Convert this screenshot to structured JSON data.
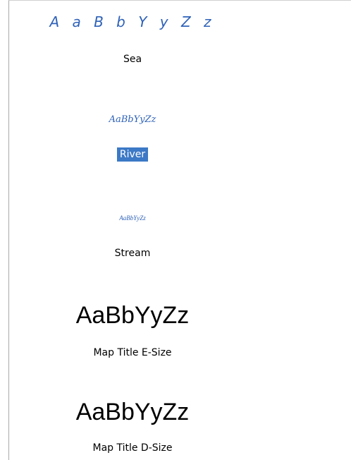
{
  "style_list": {
    "items": [
      {
        "label": "Sea",
        "sample": "A a B b Y y Z z",
        "sample_color": "#2f62b8",
        "selected": false
      },
      {
        "label": "River",
        "sample": "AaBbYyZz",
        "sample_color": "#2f62b8",
        "selected": true
      },
      {
        "label": "Stream",
        "sample": "AaBbYyZz",
        "sample_color": "#2f62b8",
        "selected": false
      },
      {
        "label": "Map Title E-Size",
        "sample": "AaBbYyZz",
        "sample_color": "#000000",
        "selected": false
      },
      {
        "label": "Map Title D-Size",
        "sample": "AaBbYyZz",
        "sample_color": "#000000",
        "selected": false
      }
    ],
    "selection_color": "#3c79c6"
  }
}
